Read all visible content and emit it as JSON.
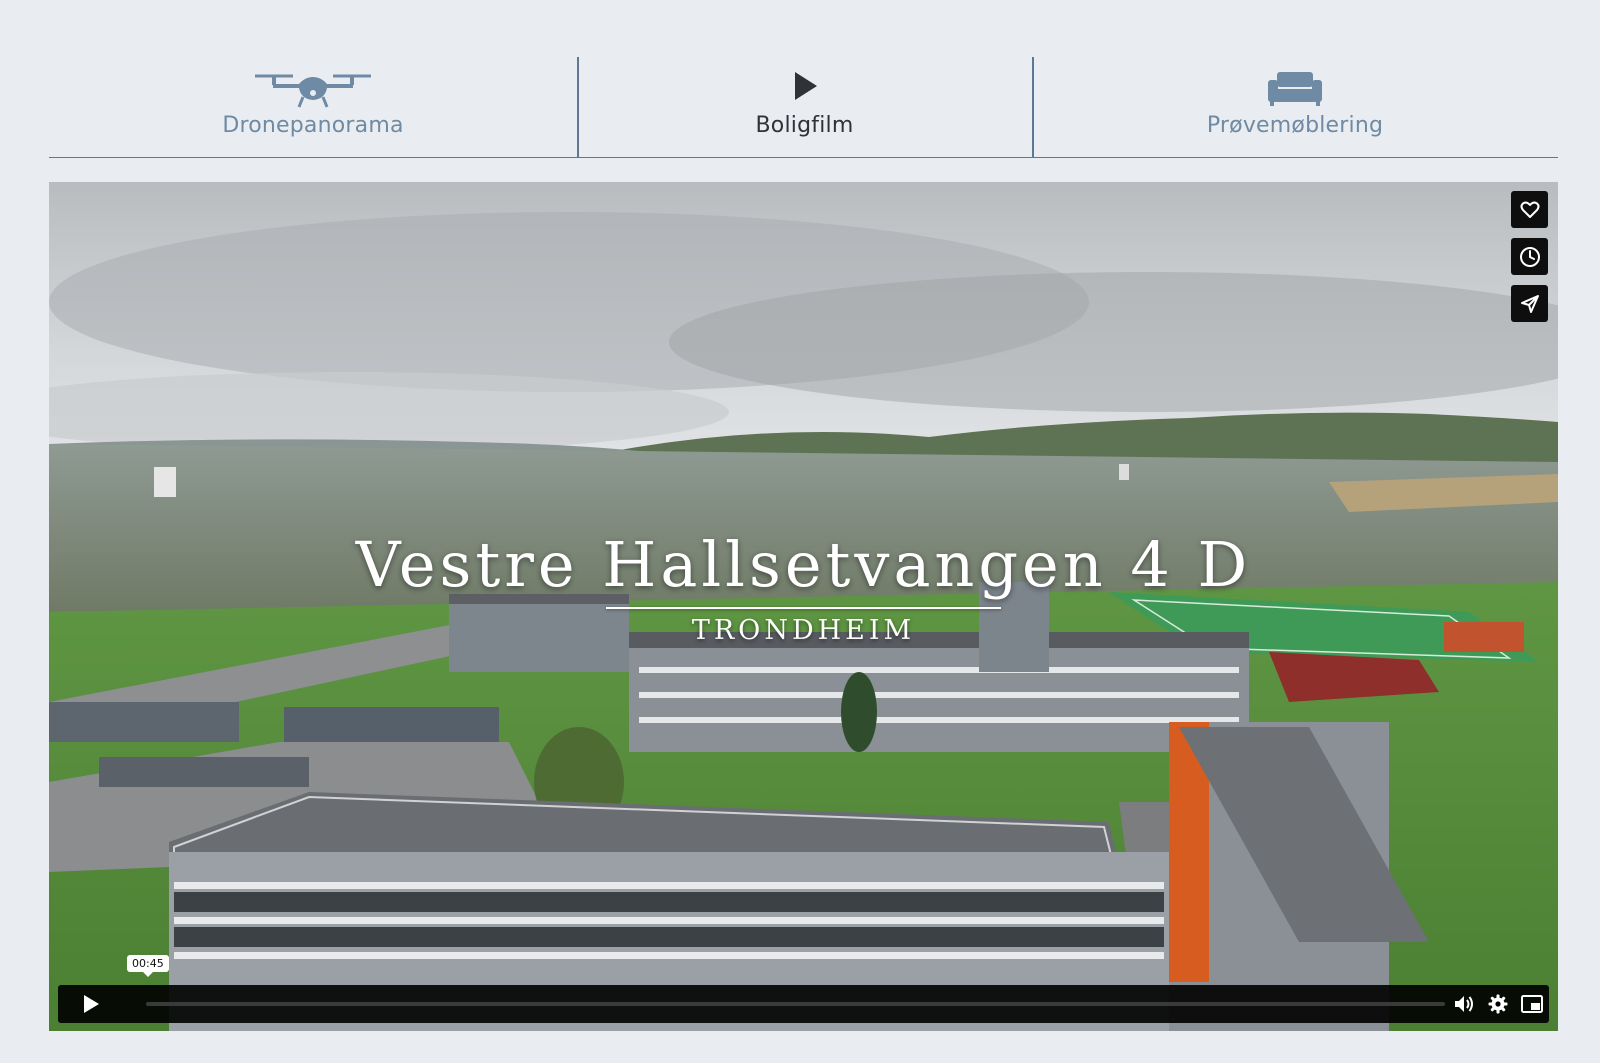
{
  "tabs": [
    {
      "label": "Dronepanorama",
      "icon": "drone-icon",
      "active": false
    },
    {
      "label": "Boligfilm",
      "icon": "play-icon",
      "active": true
    },
    {
      "label": "Prøvemøblering",
      "icon": "sofa-icon",
      "active": false
    }
  ],
  "video": {
    "title": "Vestre Hallsetvangen 4 D",
    "subtitle": "TRONDHEIM",
    "side_actions": [
      {
        "icon": "heart-icon"
      },
      {
        "icon": "clock-icon"
      },
      {
        "icon": "send-icon"
      }
    ],
    "player": {
      "time_tooltip": "00:45",
      "progress": 0.0,
      "icons": [
        "play-icon",
        "volume-icon",
        "settings-icon",
        "pip-icon"
      ]
    }
  },
  "colors": {
    "page_background": "#e9edf1",
    "tab_inactive": "#6e8aa4",
    "tab_active": "#2f3338",
    "divider": "#5d7892",
    "player_bar": "#000000"
  }
}
